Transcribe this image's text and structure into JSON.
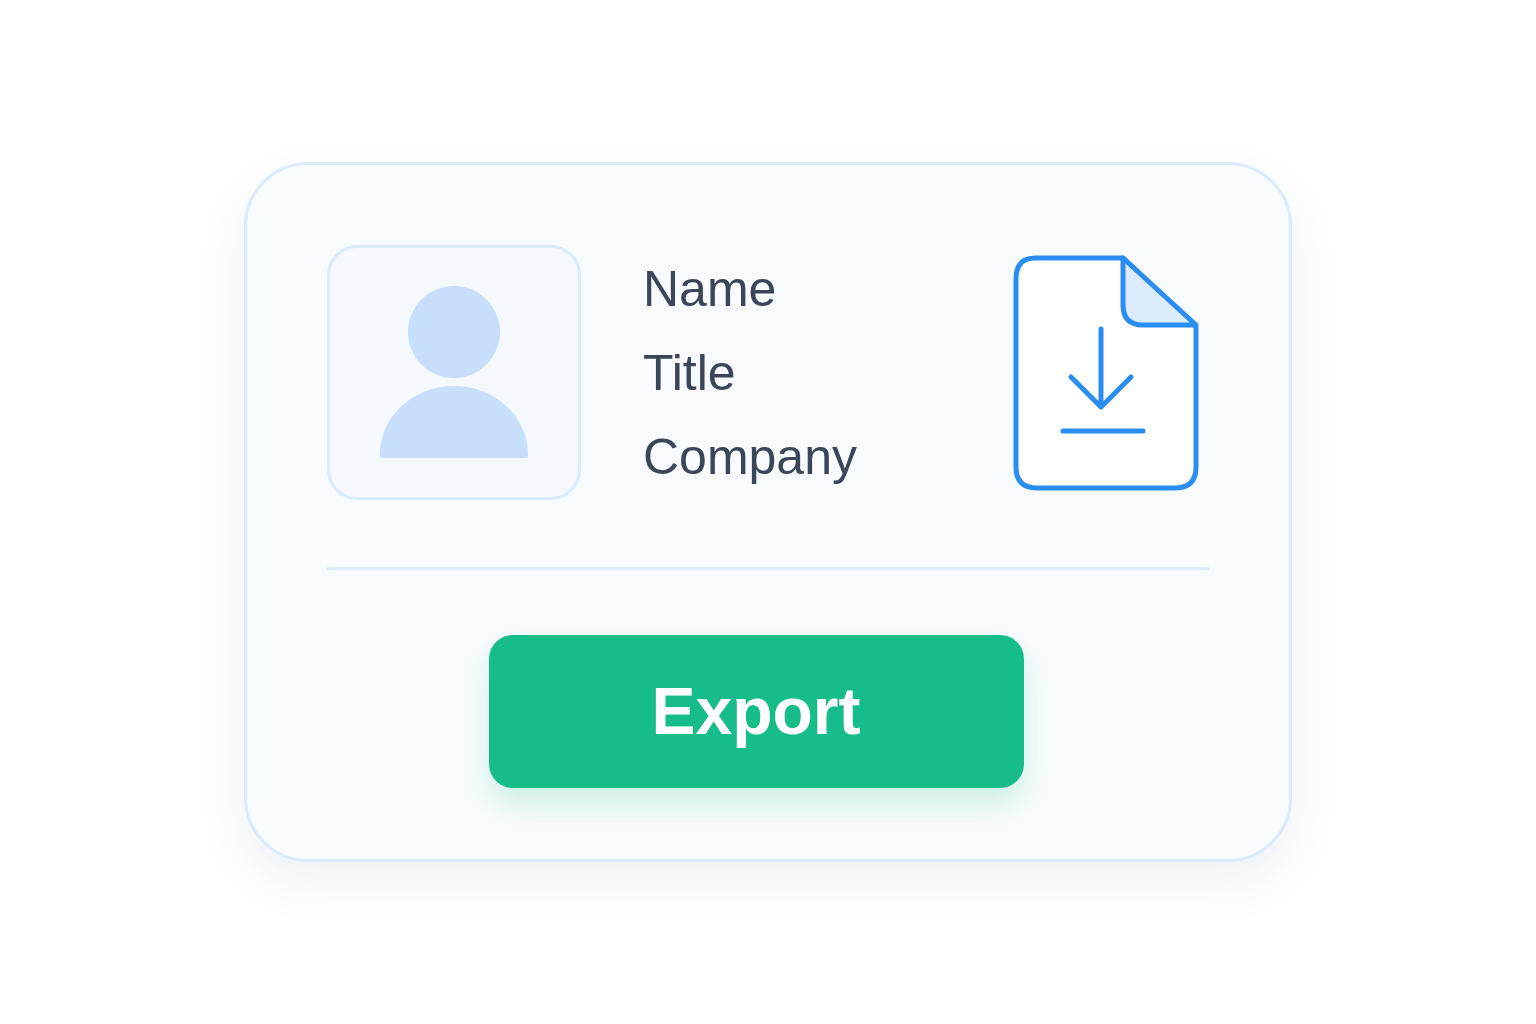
{
  "profile": {
    "fields": [
      "Name",
      "Title",
      "Company"
    ]
  },
  "export_button": {
    "label": "Export"
  }
}
